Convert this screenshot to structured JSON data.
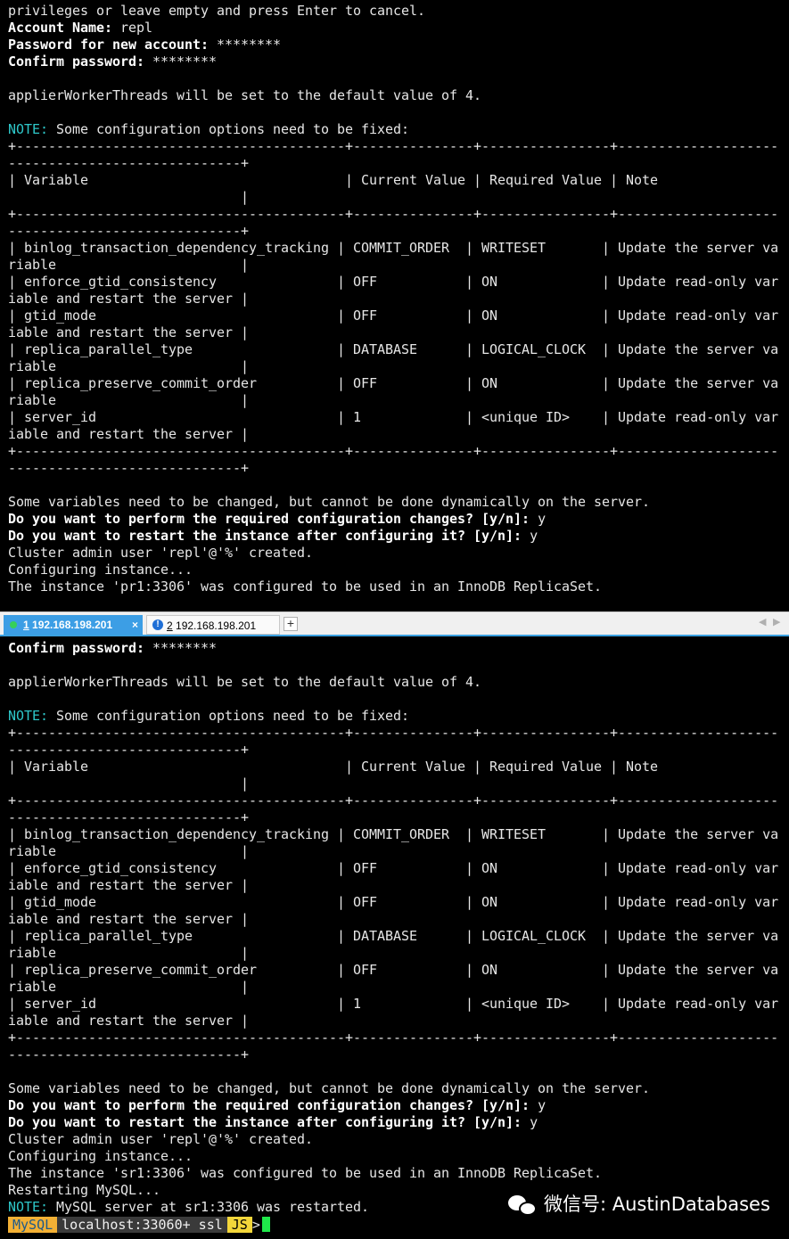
{
  "top_terminal": {
    "lines": [
      {
        "text": "privileges or leave empty and press Enter to cancel.",
        "style": ""
      },
      {
        "text": "Account Name: repl",
        "style": "",
        "bold_prefix": "Account Name:"
      },
      {
        "text": "Password for new account: ********",
        "style": "",
        "bold_prefix": "Password for new account:"
      },
      {
        "text": "Confirm password: ********",
        "style": "",
        "bold_prefix": "Confirm password:"
      },
      {
        "text": "",
        "style": ""
      },
      {
        "text": "applierWorkerThreads will be set to the default value of 4.",
        "style": ""
      },
      {
        "text": "",
        "style": ""
      },
      {
        "text": "NOTE: Some configuration options need to be fixed:",
        "style": "",
        "cyan_prefix": "NOTE:"
      },
      {
        "text": "+-----------------------------------------+---------------+----------------+--------------------",
        "style": ""
      },
      {
        "text": "-----------------------------+",
        "style": ""
      },
      {
        "text": "| Variable                                | Current Value | Required Value | Note",
        "style": ""
      },
      {
        "text": "                             |",
        "style": ""
      },
      {
        "text": "+-----------------------------------------+---------------+----------------+--------------------",
        "style": ""
      },
      {
        "text": "-----------------------------+",
        "style": ""
      },
      {
        "text": "| binlog_transaction_dependency_tracking | COMMIT_ORDER  | WRITESET       | Update the server va",
        "style": ""
      },
      {
        "text": "riable                       |",
        "style": ""
      },
      {
        "text": "| enforce_gtid_consistency               | OFF           | ON             | Update read-only var",
        "style": ""
      },
      {
        "text": "iable and restart the server |",
        "style": ""
      },
      {
        "text": "| gtid_mode                              | OFF           | ON             | Update read-only var",
        "style": ""
      },
      {
        "text": "iable and restart the server |",
        "style": ""
      },
      {
        "text": "| replica_parallel_type                  | DATABASE      | LOGICAL_CLOCK  | Update the server va",
        "style": ""
      },
      {
        "text": "riable                       |",
        "style": ""
      },
      {
        "text": "| replica_preserve_commit_order          | OFF           | ON             | Update the server va",
        "style": ""
      },
      {
        "text": "riable                       |",
        "style": ""
      },
      {
        "text": "| server_id                              | 1             | <unique ID>    | Update read-only var",
        "style": ""
      },
      {
        "text": "iable and restart the server |",
        "style": ""
      },
      {
        "text": "+-----------------------------------------+---------------+----------------+--------------------",
        "style": ""
      },
      {
        "text": "-----------------------------+",
        "style": ""
      },
      {
        "text": "",
        "style": ""
      },
      {
        "text": "Some variables need to be changed, but cannot be done dynamically on the server.",
        "style": ""
      },
      {
        "text": "Do you want to perform the required configuration changes? [y/n]: y",
        "style": "",
        "bold_prefix": "Do you want to perform the required configuration changes? [y/n]:"
      },
      {
        "text": "Do you want to restart the instance after configuring it? [y/n]: y",
        "style": "",
        "bold_prefix": "Do you want to restart the instance after configuring it? [y/n]:"
      },
      {
        "text": "Cluster admin user 'repl'@'%' created.",
        "style": ""
      },
      {
        "text": "Configuring instance...",
        "style": ""
      },
      {
        "text": "The instance 'pr1:3306' was configured to be used in an InnoDB ReplicaSet.",
        "style": ""
      }
    ]
  },
  "tabs": {
    "tab1": {
      "number": "1",
      "label": "192.168.198.201",
      "close": "×"
    },
    "tab2": {
      "number": "2",
      "label": "192.168.198.201",
      "icon": "!"
    },
    "add": "+",
    "nav_left": "◀",
    "nav_right": "▶"
  },
  "bottom_terminal": {
    "lines": [
      {
        "text": "Confirm password: ********",
        "style": "",
        "bold_prefix": "Confirm password:"
      },
      {
        "text": "",
        "style": ""
      },
      {
        "text": "applierWorkerThreads will be set to the default value of 4.",
        "style": ""
      },
      {
        "text": "",
        "style": ""
      },
      {
        "text": "NOTE: Some configuration options need to be fixed:",
        "style": "",
        "cyan_prefix": "NOTE:"
      },
      {
        "text": "+-----------------------------------------+---------------+----------------+--------------------",
        "style": ""
      },
      {
        "text": "-----------------------------+",
        "style": ""
      },
      {
        "text": "| Variable                                | Current Value | Required Value | Note",
        "style": ""
      },
      {
        "text": "                             |",
        "style": ""
      },
      {
        "text": "+-----------------------------------------+---------------+----------------+--------------------",
        "style": ""
      },
      {
        "text": "-----------------------------+",
        "style": ""
      },
      {
        "text": "| binlog_transaction_dependency_tracking | COMMIT_ORDER  | WRITESET       | Update the server va",
        "style": ""
      },
      {
        "text": "riable                       |",
        "style": ""
      },
      {
        "text": "| enforce_gtid_consistency               | OFF           | ON             | Update read-only var",
        "style": ""
      },
      {
        "text": "iable and restart the server |",
        "style": ""
      },
      {
        "text": "| gtid_mode                              | OFF           | ON             | Update read-only var",
        "style": ""
      },
      {
        "text": "iable and restart the server |",
        "style": ""
      },
      {
        "text": "| replica_parallel_type                  | DATABASE      | LOGICAL_CLOCK  | Update the server va",
        "style": ""
      },
      {
        "text": "riable                       |",
        "style": ""
      },
      {
        "text": "| replica_preserve_commit_order          | OFF           | ON             | Update the server va",
        "style": ""
      },
      {
        "text": "riable                       |",
        "style": ""
      },
      {
        "text": "| server_id                              | 1             | <unique ID>    | Update read-only var",
        "style": ""
      },
      {
        "text": "iable and restart the server |",
        "style": ""
      },
      {
        "text": "+-----------------------------------------+---------------+----------------+--------------------",
        "style": ""
      },
      {
        "text": "-----------------------------+",
        "style": ""
      },
      {
        "text": "",
        "style": ""
      },
      {
        "text": "Some variables need to be changed, but cannot be done dynamically on the server.",
        "style": ""
      },
      {
        "text": "Do you want to perform the required configuration changes? [y/n]: y",
        "style": "",
        "bold_prefix": "Do you want to perform the required configuration changes? [y/n]:"
      },
      {
        "text": "Do you want to restart the instance after configuring it? [y/n]: y",
        "style": "",
        "bold_prefix": "Do you want to restart the instance after configuring it? [y/n]:"
      },
      {
        "text": "Cluster admin user 'repl'@'%' created.",
        "style": ""
      },
      {
        "text": "Configuring instance...",
        "style": ""
      },
      {
        "text": "The instance 'sr1:3306' was configured to be used in an InnoDB ReplicaSet.",
        "style": ""
      },
      {
        "text": "Restarting MySQL...",
        "style": ""
      },
      {
        "text": "NOTE: MySQL server at sr1:3306 was restarted.",
        "style": "",
        "cyan_prefix": "NOTE:"
      }
    ]
  },
  "prompt": {
    "mysql": "MySQL",
    "host": "localhost:33060+ ssl",
    "mode": "JS",
    "symbol": ">"
  },
  "watermark": {
    "text": "微信号: AustinDatabases"
  },
  "colors": {
    "background": "#000000",
    "text": "#e6e6e6",
    "note": "#2ec7c9",
    "active_tab": "#3c9ee5",
    "cursor": "#1fe84a",
    "prompt_mysql": "#f2b035",
    "prompt_js": "#f3d63a"
  }
}
